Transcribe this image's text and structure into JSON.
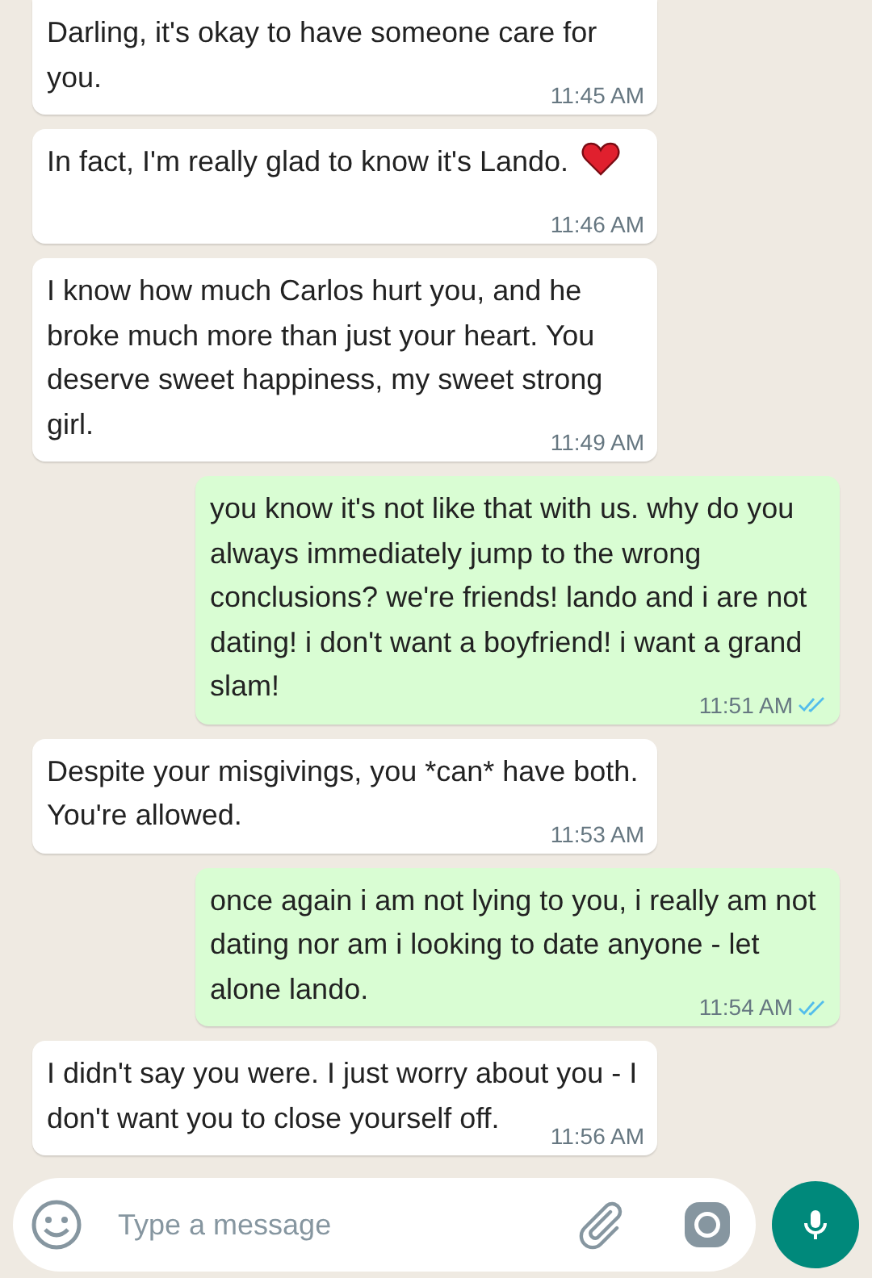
{
  "messages": [
    {
      "kind": "incoming",
      "text": "Darling, it's okay to have someone care for you.",
      "time": "11:45 AM",
      "has_heart": false
    },
    {
      "kind": "incoming",
      "text": "In fact, I'm really glad to know it's Lando.",
      "time": "11:46 AM",
      "has_heart": true
    },
    {
      "kind": "incoming",
      "text": "I know how much Carlos hurt you, and he broke much more than just your heart. You deserve sweet happiness, my sweet strong girl.",
      "time": "11:49 AM",
      "has_heart": false
    },
    {
      "kind": "outgoing",
      "text": "you know it's not like that with us. why do you always immediately jump to the wrong conclusions? we're friends! lando and i are not dating! i don't want a boyfriend! i want a grand slam!",
      "time": "11:51 AM",
      "read": true
    },
    {
      "kind": "incoming",
      "text": "Despite your misgivings, you *can* have both. You're allowed.",
      "time": "11:53 AM",
      "has_heart": false
    },
    {
      "kind": "outgoing",
      "text": "once again i am not lying to you, i really am not dating nor am i looking to date anyone - let alone lando.",
      "time": "11:54 AM",
      "read": true
    },
    {
      "kind": "incoming",
      "text": "I didn't say you were. I just worry about you - I don't want you to close yourself off.",
      "time": "11:56 AM",
      "has_heart": false
    }
  ],
  "composer": {
    "placeholder": "Type a message"
  }
}
